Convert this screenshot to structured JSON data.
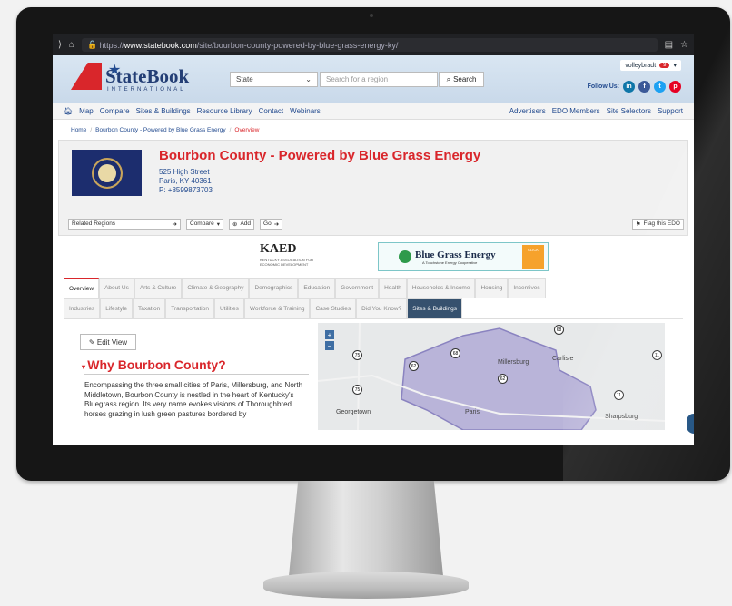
{
  "browser": {
    "url_prefix": "https://",
    "url_host": "www.statebook.com",
    "url_path": "/site/bourbon-county-powered-by-blue-grass-energy-ky/"
  },
  "header": {
    "logo_text": "StateBook",
    "logo_sub": "INTERNATIONAL",
    "state_select": "State",
    "region_placeholder": "Search for a region",
    "search_label": "Search",
    "username": "volleybradt",
    "notif_count": "9",
    "follow_label": "Follow Us:"
  },
  "nav": {
    "left": [
      "Map",
      "Compare",
      "Sites & Buildings",
      "Resource Library",
      "Contact",
      "Webinars"
    ],
    "right": [
      "Advertisers",
      "EDO Members",
      "Site Selectors",
      "Support"
    ]
  },
  "breadcrumb": {
    "home": "Home",
    "parent": "Bourbon County - Powered by Blue Grass Energy",
    "current": "Overview"
  },
  "profile": {
    "title": "Bourbon County - Powered by Blue Grass Energy",
    "street": "525 High Street",
    "city": "Paris, KY 40361",
    "phone": "P: +8599873703",
    "related": "Related Regions",
    "compare": "Compare",
    "add": "Add",
    "go": "Go",
    "flag_edo": "Flag this EDO"
  },
  "sponsors": {
    "kaed": "KAED",
    "kaed_sub": "KENTUCKY ASSOCIATION FOR ECONOMIC DEVELOPMENT",
    "bge": "Blue Grass Energy",
    "bge_sub": "A Touchstone Energy Cooperative",
    "bge_cta": "CLICK"
  },
  "tabs": {
    "row1": [
      "Overview",
      "About Us",
      "Arts & Culture",
      "Climate & Geography",
      "Demographics",
      "Education",
      "Government",
      "Health",
      "Households & Income",
      "Housing",
      "Incentives"
    ],
    "row2": [
      "Industries",
      "Lifestyle",
      "Taxation",
      "Transportation",
      "Utilities",
      "Workforce & Training",
      "Case Studies",
      "Did You Know?",
      "Sites & Buildings"
    ]
  },
  "content": {
    "edit_view": "Edit View",
    "heading": "Why Bourbon County?",
    "paragraph": "Encompassing the three small cities of Paris, Millersburg, and North Middletown, Bourbon County is nestled in the heart of Kentucky's Bluegrass region. Its very name evokes visions of Thoroughbred horses grazing in lush green pastures bordered by"
  },
  "map": {
    "labels": {
      "georgetown": "Georgetown",
      "paris": "Paris",
      "millersburg": "Millersburg",
      "carlisle": "Carlisle",
      "sharpsburg": "Sharpsburg"
    },
    "shields": {
      "s1": "75",
      "s2": "62",
      "s3": "68",
      "s4": "68",
      "s5": "11",
      "s6": "11",
      "s7": "75",
      "s8": "62"
    },
    "county_color": "#b9b4d9"
  }
}
